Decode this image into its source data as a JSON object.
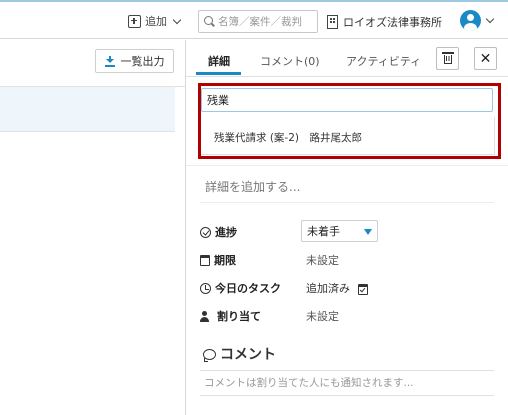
{
  "header": {
    "add_label": "追加",
    "search_placeholder": "名簿／案件／裁判",
    "office_name": "ロイオズ法律事務所"
  },
  "list": {
    "export_label": "一覧出力"
  },
  "panel": {
    "tabs": [
      "詳細",
      "コメント(0)",
      "アクティビティ"
    ],
    "matter_search": {
      "value": "残業",
      "suggestion": "残業代請求 (案-2)　路井尾太郎"
    },
    "detail_placeholder": "詳細を追加する...",
    "fields": {
      "status_label": "進捗",
      "status_value": "未着手",
      "due_label": "期限",
      "due_value": "未設定",
      "today_label": "今日のタスク",
      "today_value": "追加済み",
      "assign_label": "割り当て",
      "assign_value": "未設定"
    },
    "comment": {
      "title": "コメント",
      "placeholder": "コメントは割り当てた人にも通知されます..."
    }
  },
  "colors": {
    "accent": "#1b89c6",
    "highlight_border": "#b00000"
  }
}
